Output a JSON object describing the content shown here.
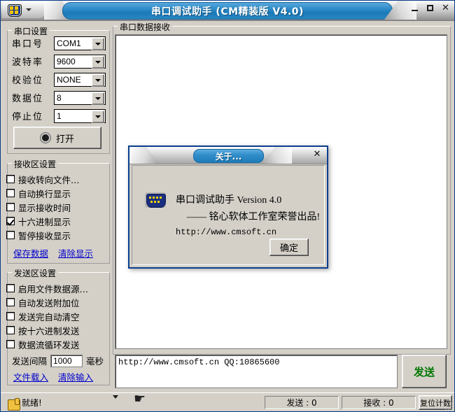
{
  "window": {
    "title": "串口调试助手 (CM精装版 V4.0)",
    "icon": "crest-icon",
    "menu_arrow": "chevron-down-icon",
    "minimize": "minimize-icon",
    "maximize": "maximize-icon",
    "close": "close-icon"
  },
  "serial_settings": {
    "group_title": "串口设置",
    "rows": [
      {
        "label": "串口号",
        "value": "COM1"
      },
      {
        "label": "波特率",
        "value": "9600"
      },
      {
        "label": "校验位",
        "value": "NONE"
      },
      {
        "label": "数据位",
        "value": "8"
      },
      {
        "label": "停止位",
        "value": "1"
      }
    ],
    "open_button": "打开"
  },
  "receive_settings": {
    "group_title": "接收区设置",
    "checkboxes": [
      {
        "label": "接收转向文件…",
        "checked": false
      },
      {
        "label": "自动换行显示",
        "checked": false
      },
      {
        "label": "显示接收时间",
        "checked": false
      },
      {
        "label": "十六进制显示",
        "checked": true
      },
      {
        "label": "暂停接收显示",
        "checked": false
      }
    ],
    "links": [
      "保存数据",
      "清除显示"
    ]
  },
  "send_settings": {
    "group_title": "发送区设置",
    "checkboxes": [
      {
        "label": "启用文件数据源…",
        "checked": false
      },
      {
        "label": "自动发送附加位",
        "checked": false
      },
      {
        "label": "发送完自动清空",
        "checked": false
      },
      {
        "label": "按十六进制发送",
        "checked": false
      },
      {
        "label": "数据流循环发送",
        "checked": false
      }
    ],
    "interval_label": "发送间隔",
    "interval_value": "1000",
    "interval_unit": "毫秒",
    "links": [
      "文件载入",
      "清除输入"
    ]
  },
  "data_area": {
    "group_title": "串口数据接收",
    "received_text": ""
  },
  "send_area": {
    "input_value": "http://www.cmsoft.cn QQ:10865600",
    "send_button": "发送"
  },
  "status_bar": {
    "icon": "pointing-hand-icon",
    "ready_text": "就绪!",
    "sent_count": "发送 : 0",
    "received_count": "接收 : 0",
    "reset_button": "复位计数"
  },
  "about_dialog": {
    "title": "关于...",
    "close": "close-icon",
    "icon": "db9-serial-connector-icon",
    "line1": "串口调试助手 Version 4.0",
    "line2": "—— 铭心软体工作室荣誉出品!",
    "line3": "http://www.cmsoft.cn",
    "ok_button": "确定"
  },
  "colors": {
    "title_blue": "#2f8cc9",
    "face": "#d4d0c8",
    "link": "#0000cc",
    "send_green": "#007700",
    "dialog_border": "#0b3f8f"
  }
}
